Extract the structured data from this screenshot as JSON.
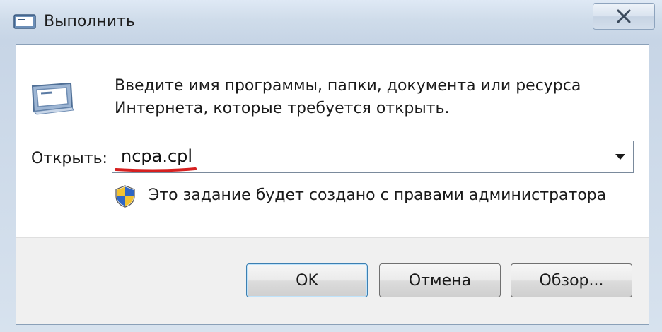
{
  "window": {
    "title": "Выполнить",
    "title_icon": "run-icon",
    "close_icon": "close-icon"
  },
  "main": {
    "description": "Введите имя программы, папки, документа или ресурса Интернета, которые требуется открыть.",
    "open_label": "Открыть:",
    "open_value": "ncpa.cpl",
    "dropdown_icon": "chevron-down-icon",
    "admin_notice": "Это задание будет создано с правами администратора",
    "shield_icon": "uac-shield-icon"
  },
  "buttons": {
    "ok": "OK",
    "cancel": "Отмена",
    "browse": "Обзор..."
  },
  "colors": {
    "underline": "#d62020",
    "ok_border": "#3c7fb1"
  }
}
